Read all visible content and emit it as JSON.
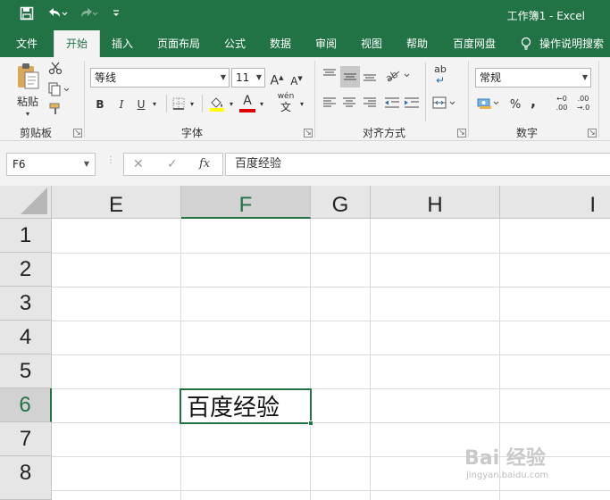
{
  "window": {
    "title": "工作簿1 - Excel",
    "quick_access": {
      "save_icon": "save-icon",
      "undo_icon": "undo-icon",
      "redo_icon": "redo-icon",
      "customize_icon": "customize-icon"
    }
  },
  "tabs": [
    "文件",
    "开始",
    "插入",
    "页面布局",
    "公式",
    "数据",
    "审阅",
    "视图",
    "帮助",
    "百度网盘",
    "操作说明搜索"
  ],
  "active_tab": "开始",
  "ribbon": {
    "clipboard": {
      "paste_label": "粘贴",
      "group_label": "剪贴板"
    },
    "font": {
      "font_name": "等线",
      "font_size": "11",
      "bold": "B",
      "italic": "I",
      "underline": "U",
      "grow": "A",
      "shrink": "A",
      "font_color_letter": "A",
      "phonetic": "wén",
      "group_label": "字体"
    },
    "alignment": {
      "wrap": "ab",
      "group_label": "对齐方式"
    },
    "number": {
      "format": "常规",
      "percent": "%",
      "comma": ",",
      "inc_decimal_top": "←0",
      "inc_decimal_bottom": ".00",
      "dec_decimal_top": ".00",
      "dec_decimal_bottom": "→.0",
      "group_label": "数字"
    }
  },
  "formula_bar": {
    "name_box": "F6",
    "cancel": "✕",
    "enter": "✓",
    "fx": "fx",
    "content": "百度经验"
  },
  "sheet": {
    "columns": [
      "E",
      "F",
      "G",
      "H",
      "I"
    ],
    "rows": [
      "1",
      "2",
      "3",
      "4",
      "5",
      "6",
      "7",
      "8"
    ],
    "selected_column": "F",
    "selected_row": "6",
    "active_cell_value": "百度经验"
  },
  "watermark": {
    "main": "Bai 经验",
    "sub": "jingyan.baidu.com"
  },
  "colors": {
    "accent": "#217346",
    "ribbon_bg": "#f3f3f3",
    "header_bg": "#e6e6e6"
  }
}
